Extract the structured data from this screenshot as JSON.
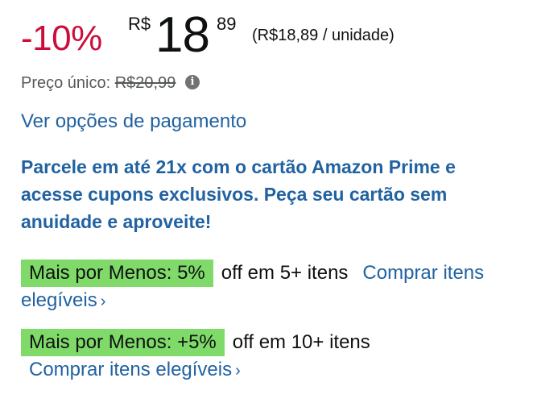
{
  "price": {
    "discount": "-10%",
    "currency": "R$",
    "whole": "18",
    "fraction": "89",
    "unit_price": "(R$18,89 / unidade)"
  },
  "single_price": {
    "label": "Preço único:",
    "old_price": "R$20,99",
    "info_icon": "info-icon"
  },
  "payment": {
    "link": "Ver opções de pagamento"
  },
  "promo": {
    "text": "Parcele em até 21x com o cartão Amazon Prime e acesse cupons exclusivos. Peça seu cartão sem anuidade e aproveite!"
  },
  "offers": [
    {
      "badge": "Mais por Menos: 5%",
      "text": "off em 5+ itens",
      "link": "Comprar itens elegíveis"
    },
    {
      "badge": "Mais por Menos: +5%",
      "text": "off em 10+ itens",
      "link": "Comprar itens elegíveis"
    }
  ],
  "colors": {
    "discount": "#cc0c39",
    "link": "#2162a1",
    "badge": "#7fda69",
    "muted": "#565959"
  }
}
